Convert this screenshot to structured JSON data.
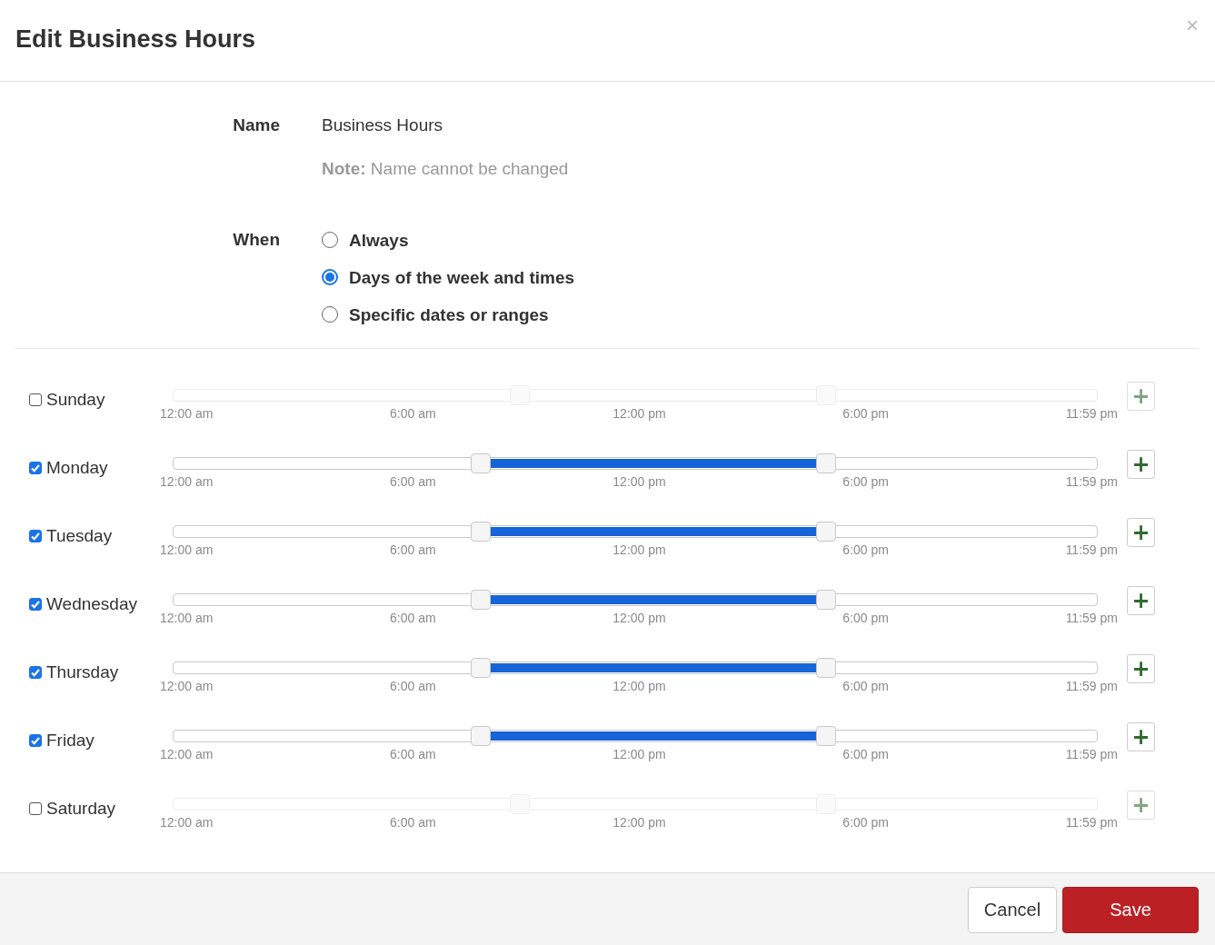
{
  "dialog": {
    "title": "Edit Business Hours",
    "close": "×"
  },
  "name_field": {
    "label": "Name",
    "value": "Business Hours",
    "note_label": "Note:",
    "note": "Name cannot be changed"
  },
  "when": {
    "label": "When",
    "options": [
      {
        "label": "Always",
        "selected": false
      },
      {
        "label": "Days of the week and times",
        "selected": true
      },
      {
        "label": "Specific dates or ranges",
        "selected": false
      }
    ]
  },
  "days": [
    {
      "name": "Sunday",
      "checked": false,
      "handles": [
        {
          "level": 0.375
        },
        {
          "level": 0.707
        }
      ],
      "ticks": [
        "12:00 am",
        "6:00 am",
        "12:00 pm",
        "6:00 pm",
        "11:59 pm"
      ],
      "add": "+"
    },
    {
      "name": "Monday",
      "checked": true,
      "handles": [
        {
          "level": 0.333
        },
        {
          "level": 0.707
        }
      ],
      "ticks": [
        "12:00 am",
        "6:00 am",
        "12:00 pm",
        "6:00 pm",
        "11:59 pm"
      ],
      "add": "+"
    },
    {
      "name": "Tuesday",
      "checked": true,
      "handles": [
        {
          "level": 0.333
        },
        {
          "level": 0.707
        }
      ],
      "ticks": [
        "12:00 am",
        "6:00 am",
        "12:00 pm",
        "6:00 pm",
        "11:59 pm"
      ],
      "add": "+"
    },
    {
      "name": "Wednesday",
      "checked": true,
      "handles": [
        {
          "level": 0.333
        },
        {
          "level": 0.707
        }
      ],
      "ticks": [
        "12:00 am",
        "6:00 am",
        "12:00 pm",
        "6:00 pm",
        "11:59 pm"
      ],
      "add": "+"
    },
    {
      "name": "Thursday",
      "checked": true,
      "handles": [
        {
          "level": 0.333
        },
        {
          "level": 0.707
        }
      ],
      "ticks": [
        "12:00 am",
        "6:00 am",
        "12:00 pm",
        "6:00 pm",
        "11:59 pm"
      ],
      "add": "+"
    },
    {
      "name": "Friday",
      "checked": true,
      "handles": [
        {
          "level": 0.333
        },
        {
          "level": 0.707
        }
      ],
      "ticks": [
        "12:00 am",
        "6:00 am",
        "12:00 pm",
        "6:00 pm",
        "11:59 pm"
      ],
      "add": "+"
    },
    {
      "name": "Saturday",
      "checked": false,
      "handles": [
        {
          "level": 0.375
        },
        {
          "level": 0.707
        }
      ],
      "ticks": [
        "12:00 am",
        "6:00 am",
        "12:00 pm",
        "6:00 pm",
        "11:59 pm"
      ],
      "add": "+"
    }
  ],
  "buttons": [
    {
      "label": "Cancel",
      "kind": "secondary"
    },
    {
      "label": "Save",
      "kind": "primary"
    }
  ]
}
